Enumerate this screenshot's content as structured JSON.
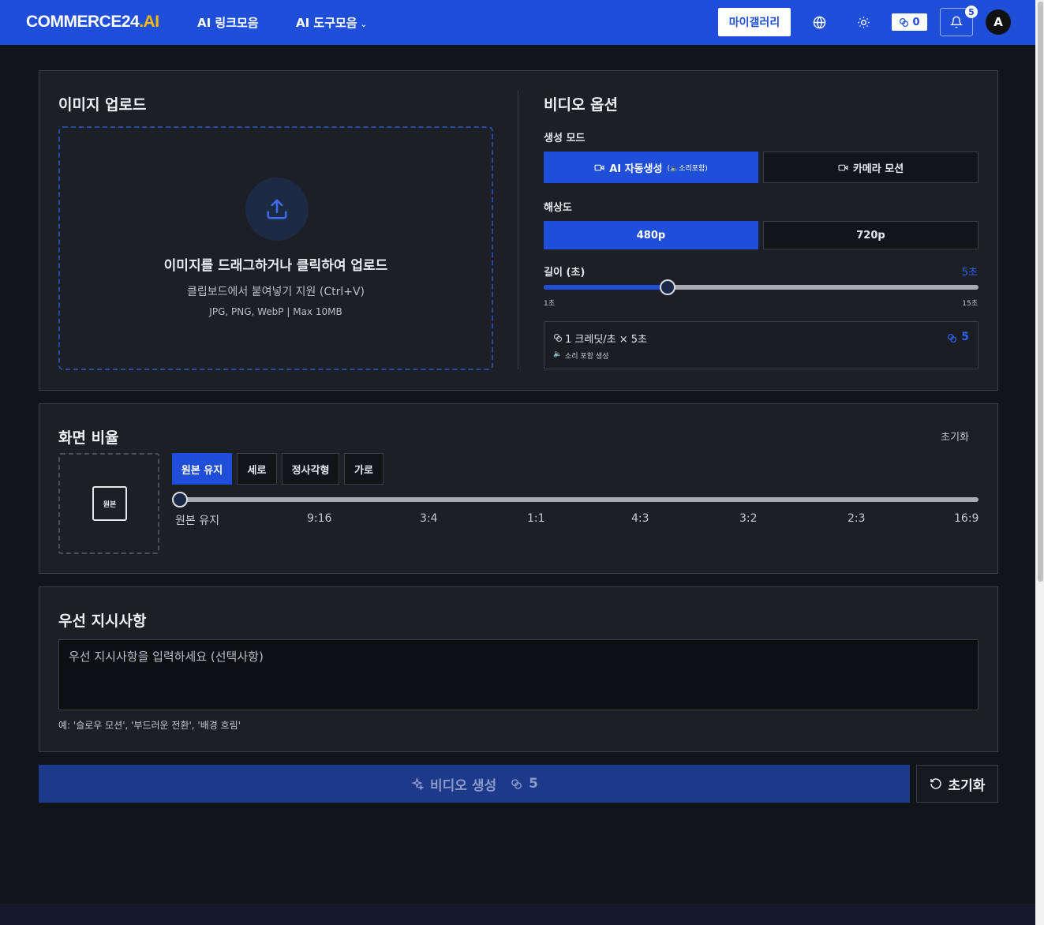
{
  "header": {
    "logo_main": "COMMERCE24",
    "logo_suffix": ".AI",
    "nav_links": "AI 링크모음",
    "nav_tools": "AI 도구모음",
    "gallery_label": "마이갤러리",
    "credits": "0",
    "notification_count": "5",
    "avatar_letter": "A"
  },
  "upload": {
    "title": "이미지 업로드",
    "main_text": "이미지를 드래그하거나 클릭하여 업로드",
    "sub_text": "클립보드에서 붙여넣기 지원 (Ctrl+V)",
    "formats_text": "JPG, PNG, WebP | Max 10MB"
  },
  "video_options": {
    "title": "비디오 옵션",
    "mode_label": "생성 모드",
    "mode_auto": "AI 자동생성",
    "mode_auto_note": "(🔈소리포함)",
    "mode_camera": "카메라 모션",
    "resolution_label": "해상도",
    "res_480": "480p",
    "res_720": "720p",
    "length_label": "길이 (초)",
    "length_value": "5초",
    "length_min": "1초",
    "length_max": "15초",
    "length_fraction": 0.2857,
    "cost_formula": "1 크레딧/초 × 5초",
    "cost_total": "5",
    "cost_note": "소리 포함 생성"
  },
  "aspect": {
    "title": "화면 비율",
    "reset_label": "초기화",
    "preview_label": "원본",
    "tabs": [
      "원본 유지",
      "세로",
      "정사각형",
      "가로"
    ],
    "ticks": [
      "원본 유지",
      "9:16",
      "3:4",
      "1:1",
      "4:3",
      "3:2",
      "2:3",
      "16:9"
    ],
    "slider_fraction": 0
  },
  "priority": {
    "title": "우선 지시사항",
    "placeholder": "우선 지시사항을 입력하세요 (선택사항)",
    "hint": "예: '슬로우 모션', '부드러운 전환', '배경 흐림'"
  },
  "actions": {
    "generate_label": "비디오 생성",
    "generate_cost": "5",
    "reset_label": "초기화"
  },
  "colors": {
    "accent": "#1f4fd8",
    "logo_accent": "#ffb800",
    "panel_bg": "#1c1f25",
    "page_bg": "#111418"
  }
}
